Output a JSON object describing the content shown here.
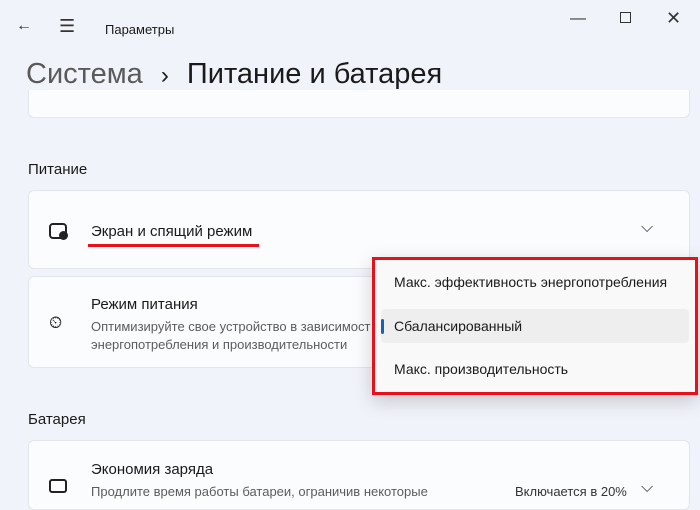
{
  "window": {
    "title": "Параметры"
  },
  "breadcrumb": {
    "parent": "Система",
    "separator": "›",
    "current": "Питание и батарея"
  },
  "sections": {
    "power": "Питание",
    "battery": "Батарея"
  },
  "cards": {
    "screen_sleep": {
      "title": "Экран и спящий режим"
    },
    "power_mode": {
      "title": "Режим питания",
      "desc1": "Оптимизируйте свое устройство в зависимост",
      "desc2": "энергопотребления и производительности"
    },
    "battery_saver": {
      "title": "Экономия заряда",
      "desc": "Продлите время работы батареи, ограничив некоторые",
      "value": "Включается в 20%"
    }
  },
  "dropdown": {
    "options": [
      "Макс. эффективность энергопотребления",
      "Сбалансированный",
      "Макс. производительность"
    ],
    "selected": "Сбалансированный"
  },
  "colors": {
    "highlight": "#e8101a",
    "accent": "#1a5fb4"
  }
}
